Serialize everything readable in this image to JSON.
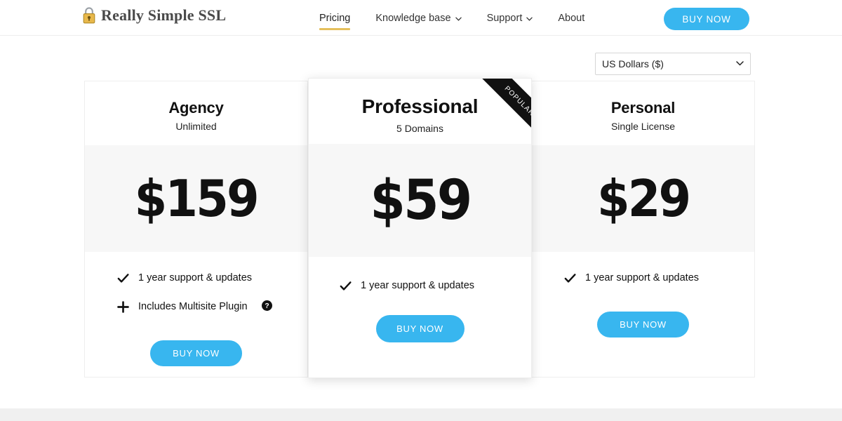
{
  "header": {
    "brand_name": "Really Simple SSL",
    "brand_icon": "padlock-icon",
    "nav": [
      {
        "label": "Pricing",
        "active": true,
        "has_chevron": false
      },
      {
        "label": "Knowledge base",
        "active": false,
        "has_chevron": true
      },
      {
        "label": "Support",
        "active": false,
        "has_chevron": true
      },
      {
        "label": "About",
        "active": false,
        "has_chevron": false
      }
    ],
    "cta_label": "BUY NOW",
    "accent_underline_color": "#e5c05c",
    "cta_color": "#38b6ef"
  },
  "currency": {
    "selected": "US Dollars ($)",
    "options": [
      "US Dollars ($)"
    ],
    "arrow_icon": "chevron-down-icon"
  },
  "pricing": {
    "ribbon_label": "POPULAR",
    "plans": [
      {
        "name": "Agency",
        "subtitle": "Unlimited",
        "price": "$159",
        "featured": false,
        "features": [
          {
            "icon": "check-icon",
            "text": "1 year support & updates",
            "help": false
          },
          {
            "icon": "plus-icon",
            "text": "Includes Multisite Plugin",
            "help": true,
            "help_icon": "question-mark-icon"
          }
        ],
        "cta_label": "BUY NOW"
      },
      {
        "name": "Professional",
        "subtitle": "5 Domains",
        "price": "$59",
        "featured": true,
        "features": [
          {
            "icon": "check-icon",
            "text": "1 year support & updates",
            "help": false
          }
        ],
        "cta_label": "BUY NOW"
      },
      {
        "name": "Personal",
        "subtitle": "Single License",
        "price": "$29",
        "featured": false,
        "features": [
          {
            "icon": "check-icon",
            "text": "1 year support & updates",
            "help": false
          }
        ],
        "cta_label": "BUY NOW"
      }
    ]
  }
}
